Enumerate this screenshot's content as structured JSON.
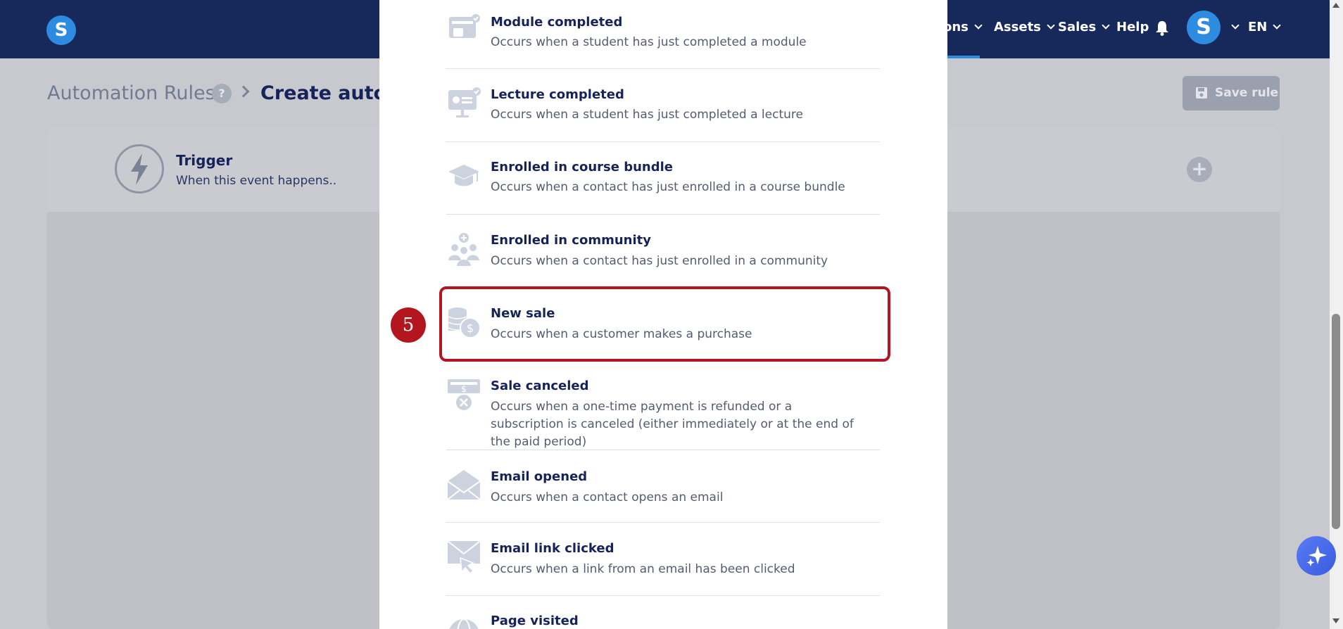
{
  "nav": {
    "items": [
      {
        "label": "ons"
      },
      {
        "label": "Assets"
      },
      {
        "label": "Sales"
      },
      {
        "label": "Help"
      }
    ],
    "logo_letter": "S",
    "avatar_letter": "S",
    "language": "EN"
  },
  "page": {
    "breadcrumb_root": "Automation Rules",
    "help_badge": "?",
    "breadcrumb_current": "Create autom",
    "save_label": "Save rule"
  },
  "trigger": {
    "title": "Trigger",
    "subtitle": "When this event happens.."
  },
  "events": [
    {
      "icon": "module-icon",
      "title": "Module completed",
      "desc": "Occurs when a student has just completed a module"
    },
    {
      "icon": "lecture-icon",
      "title": "Lecture completed",
      "desc": "Occurs when a student has just completed a lecture"
    },
    {
      "icon": "graduation-cap-icon",
      "title": "Enrolled in course bundle",
      "desc": "Occurs when a contact has just enrolled in a course bundle"
    },
    {
      "icon": "community-icon",
      "title": "Enrolled in community",
      "desc": "Occurs when a contact has just enrolled in a community"
    },
    {
      "icon": "coins-icon",
      "title": "New sale",
      "desc": "Occurs when a customer makes a purchase"
    },
    {
      "icon": "refund-icon",
      "title": "Sale canceled",
      "desc": "Occurs when a one-time payment is refunded or a subscription is canceled (either immediately or at the end of the paid period)"
    },
    {
      "icon": "envelope-open-icon",
      "title": "Email opened",
      "desc": "Occurs when a contact opens an email"
    },
    {
      "icon": "envelope-click-icon",
      "title": "Email link clicked",
      "desc": "Occurs when a link from an email has been clicked"
    },
    {
      "icon": "globe-icon",
      "title": "Page visited",
      "desc": ""
    }
  ],
  "annotation": {
    "step": "5"
  },
  "colors": {
    "nav_bg": "#16295a",
    "accent": "#2d8be0",
    "highlight": "#b3161f"
  }
}
